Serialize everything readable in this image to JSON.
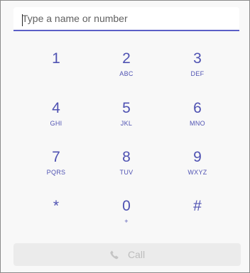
{
  "search": {
    "placeholder": "Type a name or number",
    "value": ""
  },
  "keypad": [
    {
      "digit": "1",
      "letters": ""
    },
    {
      "digit": "2",
      "letters": "ABC"
    },
    {
      "digit": "3",
      "letters": "DEF"
    },
    {
      "digit": "4",
      "letters": "GHI"
    },
    {
      "digit": "5",
      "letters": "JKL"
    },
    {
      "digit": "6",
      "letters": "MNO"
    },
    {
      "digit": "7",
      "letters": "PQRS"
    },
    {
      "digit": "8",
      "letters": "TUV"
    },
    {
      "digit": "9",
      "letters": "WXYZ"
    },
    {
      "digit": "*",
      "letters": ""
    },
    {
      "digit": "0",
      "letters": "+"
    },
    {
      "digit": "#",
      "letters": ""
    }
  ],
  "call": {
    "label": "Call",
    "icon": "phone-icon",
    "disabled": true
  },
  "colors": {
    "accent": "#5b5fc7",
    "digit": "#4f52b2",
    "disabled": "#bdbdbd"
  }
}
